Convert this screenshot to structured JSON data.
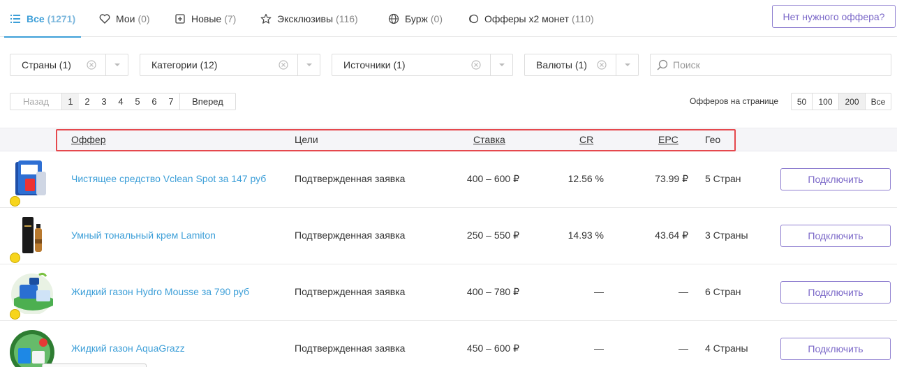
{
  "tabs": [
    {
      "label": "Все",
      "count": "(1271)",
      "icon": "list-icon",
      "active": true
    },
    {
      "label": "Мои",
      "count": "(0)",
      "icon": "heart-icon"
    },
    {
      "label": "Новые",
      "count": "(7)",
      "icon": "plus-square-icon"
    },
    {
      "label": "Эксклюзивы",
      "count": "(116)",
      "icon": "star-icon"
    },
    {
      "label": "Бурж",
      "count": "(0)",
      "icon": "globe-icon"
    },
    {
      "label": "Офферы x2 монет",
      "count": "(110)",
      "icon": "coin-icon"
    }
  ],
  "need_offer_button": "Нет нужного оффера?",
  "filters": [
    {
      "label": "Страны (1)"
    },
    {
      "label": "Категории (12)"
    },
    {
      "label": "Источники (1)"
    },
    {
      "label": "Валюты (1)"
    }
  ],
  "search": {
    "placeholder": "Поиск"
  },
  "pagination": {
    "prev": "Назад",
    "pages": [
      "1",
      "2",
      "3",
      "4",
      "5",
      "6",
      "7"
    ],
    "current": "1",
    "next": "Вперед"
  },
  "per_page": {
    "label": "Офферов на странице",
    "options": [
      "50",
      "100",
      "200",
      "Все"
    ],
    "selected": "200"
  },
  "table": {
    "headers": {
      "offer": "Оффер",
      "goals": "Цели",
      "rate": "Ставка",
      "cr": "CR",
      "epc": "EPC",
      "geo": "Гео"
    },
    "highlight_color": "#e5484d",
    "connect_label": "Подключить",
    "rows": [
      {
        "name": "Чистящее средство Vclean Spot за 147 руб",
        "goal": "Подтвержденная заявка",
        "rate": "400 – 600 ₽",
        "cr": "12.56 %",
        "epc": "73.99 ₽",
        "geo": "5 Стран",
        "thumb": "cleaner-box"
      },
      {
        "name": "Умный тональный крем Lamiton",
        "goal": "Подтвержденная заявка",
        "rate": "250 – 550 ₽",
        "cr": "14.93 %",
        "epc": "43.64 ₽",
        "geo": "3 Страны",
        "thumb": "cream-bottle"
      },
      {
        "name": "Жидкий газон Hydro Mousse за 790 руб",
        "goal": "Подтвержденная заявка",
        "rate": "400 – 780 ₽",
        "cr": "—",
        "epc": "—",
        "geo": "6 Стран",
        "thumb": "lawn-sprayer"
      },
      {
        "name": "Жидкий газон AquaGrazz",
        "goal": "Подтвержденная заявка",
        "rate": "450 – 600 ₽",
        "cr": "—",
        "epc": "—",
        "geo": "4 Страны",
        "thumb": "lawn-circle"
      }
    ]
  },
  "colors": {
    "accent": "#3d9fd8",
    "button": "#7b68c8",
    "status_dot": "#f7d51d"
  }
}
